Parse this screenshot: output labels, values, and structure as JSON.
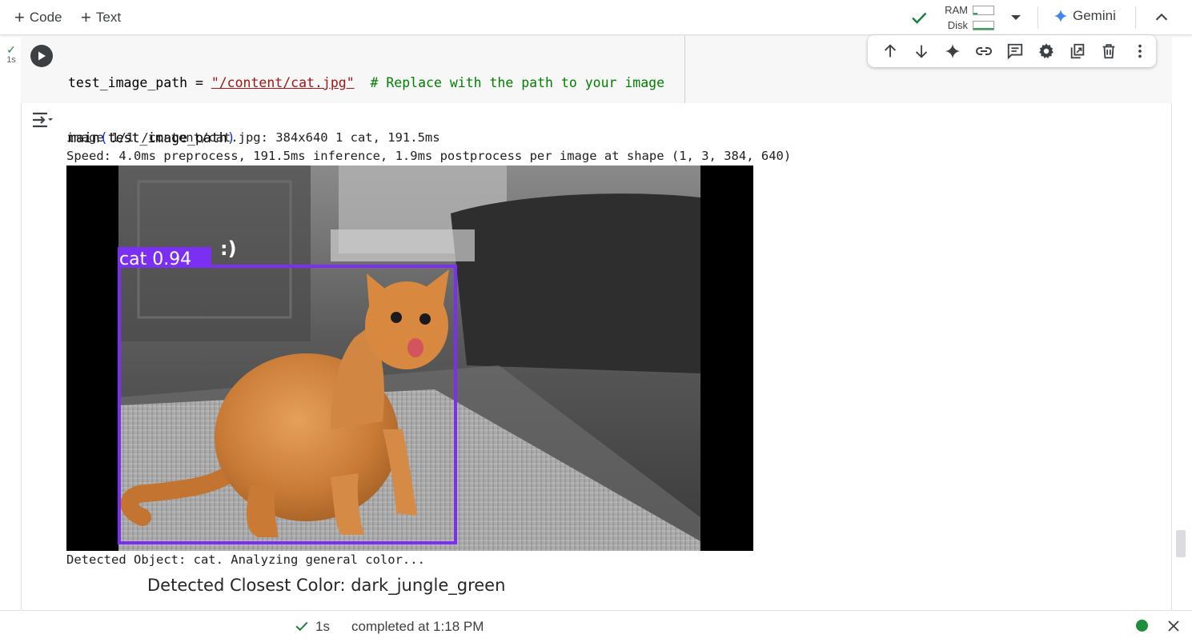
{
  "toolbar": {
    "add_code_label": "Code",
    "add_text_label": "Text",
    "ram_label": "RAM",
    "disk_label": "Disk",
    "gemini_label": "Gemini"
  },
  "cell": {
    "exec_duration": "1s",
    "code_lines": [
      {
        "name": "test_image_path = ",
        "string": "\"/content/cat.jpg\"",
        "comment": "  # Replace with the path to your image"
      },
      {
        "call": "main",
        "arg": "test_image_path"
      }
    ],
    "cell_toolbar_icons": [
      "arrow-up-icon",
      "arrow-down-icon",
      "sparkle-icon",
      "link-icon",
      "comment-icon",
      "gear-icon",
      "mirror-cell-icon",
      "trash-icon",
      "more-vert-icon"
    ]
  },
  "output": {
    "line1": "image 1/1 /content/cat.jpg: 384x640 1 cat, 191.5ms",
    "line2": "Speed: 4.0ms preprocess, 191.5ms inference, 1.9ms postprocess per image at shape (1, 3, 384, 640)",
    "detection_label": "cat 0.94",
    "overlay_text": ":)",
    "line3": "Detected Object: cat. Analyzing general color...",
    "plot_title": "Detected Closest Color: dark_jungle_green"
  },
  "status": {
    "duration": "1s",
    "completed_text": "completed at 1:18 PM"
  },
  "colors": {
    "accent_green": "#188038",
    "bbox_purple": "#7b2ff2",
    "gemini_blue": "#4285f4",
    "connected_dot": "#1e8e3e"
  }
}
